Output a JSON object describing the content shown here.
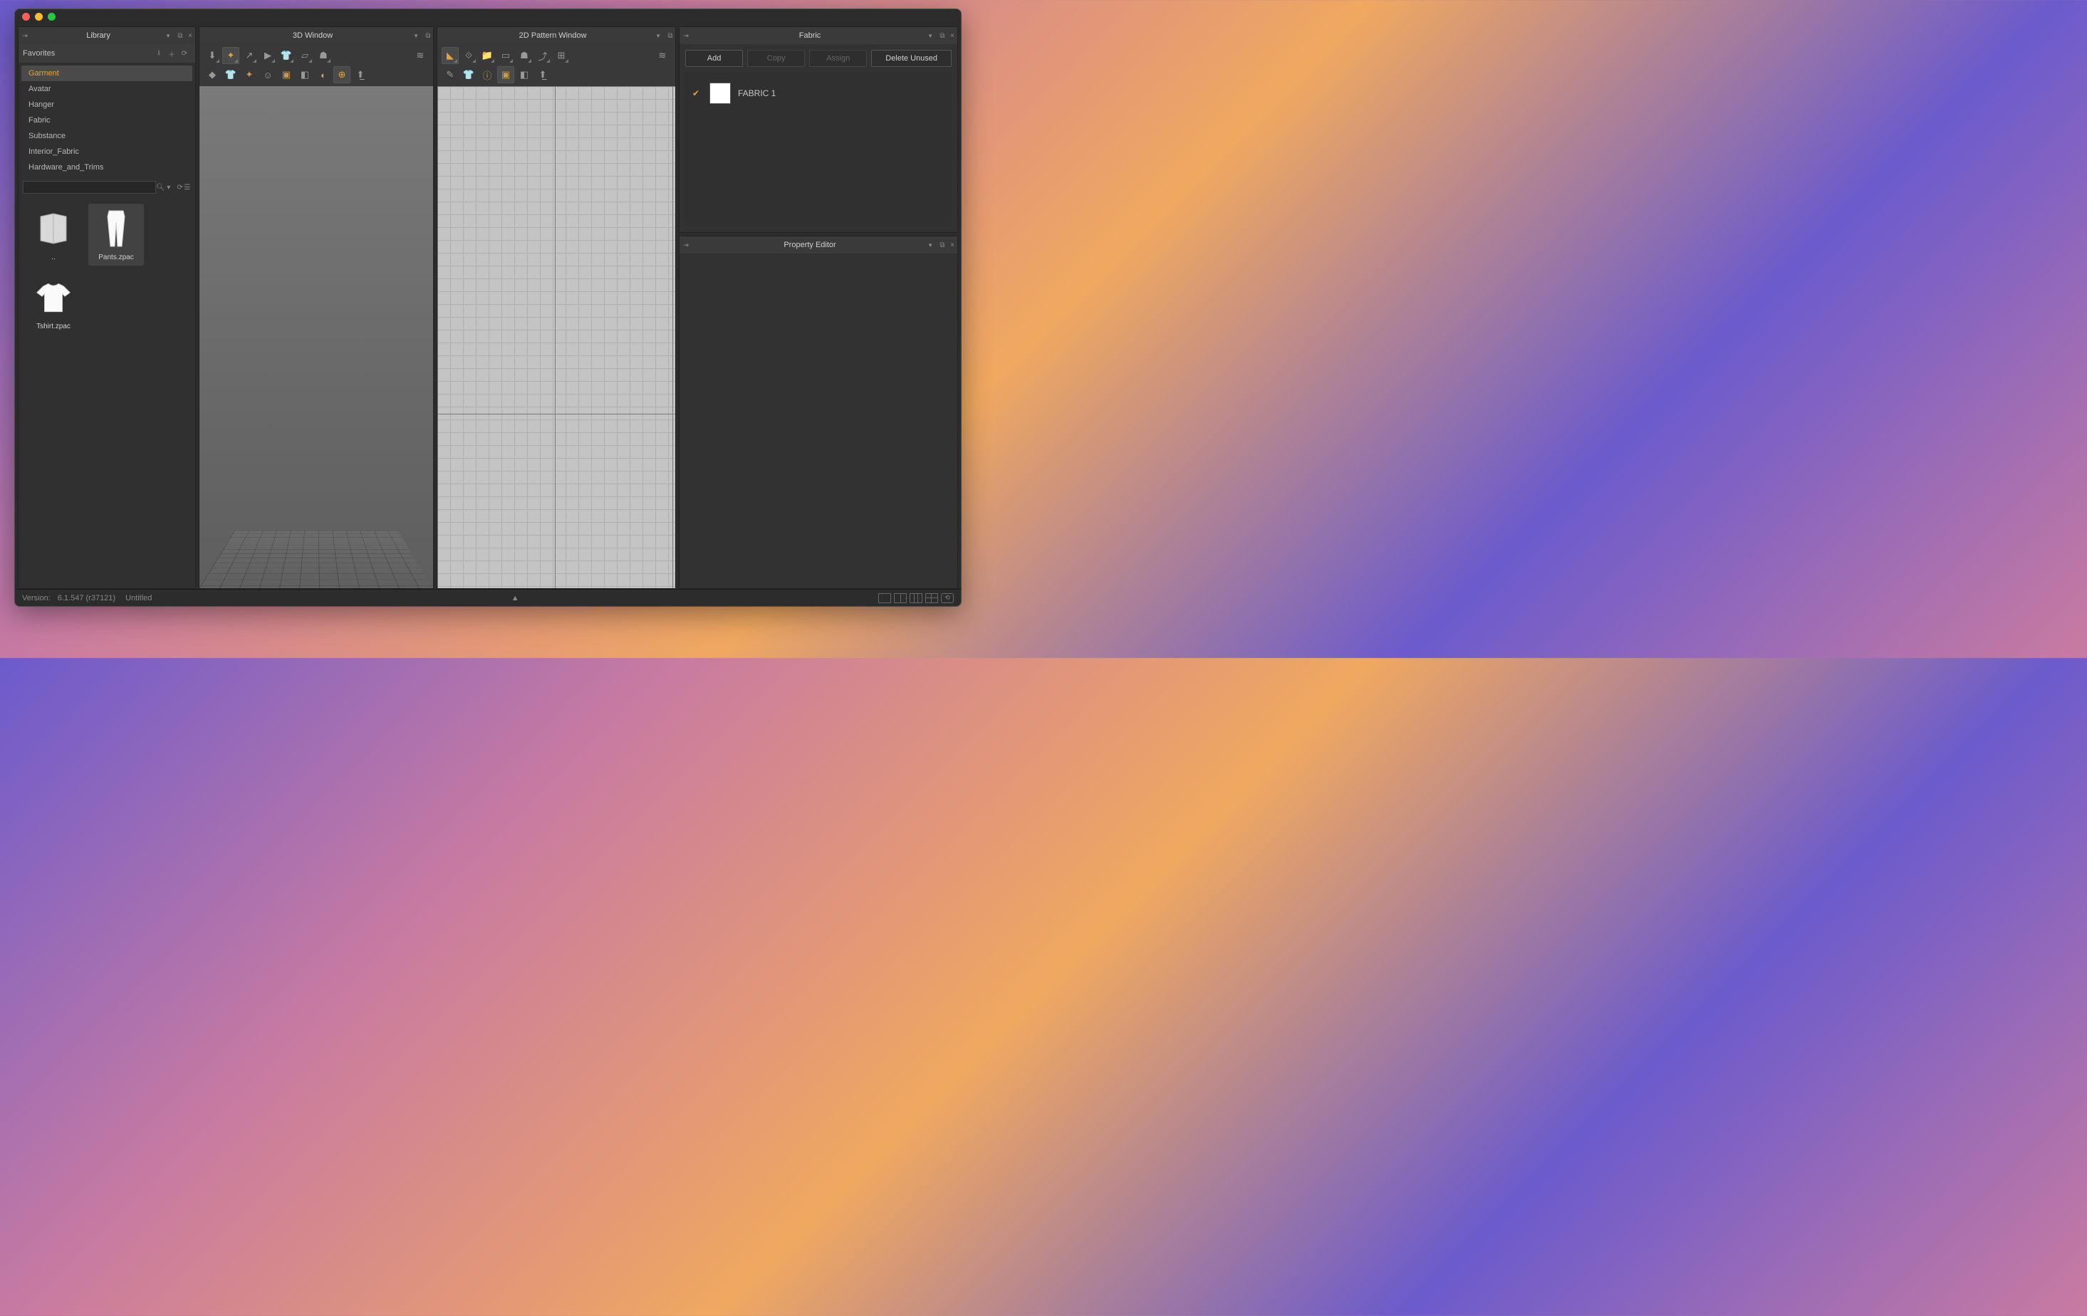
{
  "panels": {
    "library": {
      "title": "Library",
      "favorites_label": "Favorites"
    },
    "window3d": {
      "title": "3D Window"
    },
    "window2d": {
      "title": "2D Pattern Window"
    },
    "fabric": {
      "title": "Fabric"
    },
    "property": {
      "title": "Property Editor"
    }
  },
  "categories": [
    {
      "label": "Garment",
      "active": true
    },
    {
      "label": "Avatar"
    },
    {
      "label": "Hanger"
    },
    {
      "label": "Fabric"
    },
    {
      "label": "Substance"
    },
    {
      "label": "Interior_Fabric"
    },
    {
      "label": "Hardware_and_Trims"
    }
  ],
  "files": [
    {
      "label": "..",
      "kind": "folder-up"
    },
    {
      "label": "Pants.zpac",
      "kind": "pants",
      "selected": true
    },
    {
      "label": "Tshirt.zpac",
      "kind": "tshirt"
    }
  ],
  "fabric_actions": {
    "add": "Add",
    "copy": "Copy",
    "assign": "Assign",
    "delete_unused": "Delete Unused"
  },
  "fabrics": [
    {
      "name": "FABRIC 1",
      "checked": true
    }
  ],
  "status": {
    "version_label": "Version:",
    "version_value": "6.1.547 (r37121)",
    "document": "Untitled"
  },
  "canvas2d_watermark": ""
}
